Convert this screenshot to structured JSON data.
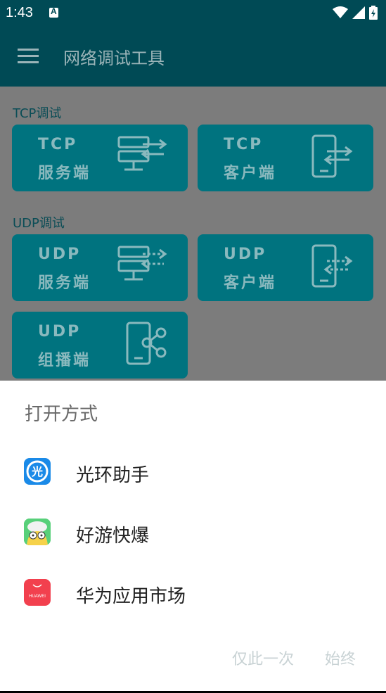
{
  "status": {
    "time": "1:43",
    "notif_letter": "A"
  },
  "app_bar": {
    "title": "网络调试工具"
  },
  "sections": {
    "tcp": {
      "label": "TCP调试"
    },
    "udp": {
      "label": "UDP调试"
    }
  },
  "cards": {
    "tcp_server": {
      "line1": "TCP",
      "line2": "服务端"
    },
    "tcp_client": {
      "line1": "TCP",
      "line2": "客户端"
    },
    "udp_server": {
      "line1": "UDP",
      "line2": "服务端"
    },
    "udp_client": {
      "line1": "UDP",
      "line2": "客户端"
    },
    "udp_multicast": {
      "line1": "UDP",
      "line2": "组播端"
    }
  },
  "sheet": {
    "title": "打开方式",
    "apps": [
      {
        "name": "光环助手",
        "icon": "guanghuan-icon"
      },
      {
        "name": "好游快爆",
        "icon": "haoyou-icon"
      },
      {
        "name": "华为应用市场",
        "icon": "huawei-appgallery-icon"
      }
    ],
    "huawei_icon_text": "HUAWEI",
    "btn_once": "仅此一次",
    "btn_always": "始终"
  },
  "colors": {
    "app_bar": "#004a55",
    "card": "#00737f",
    "dim_bg": "#7c7c7c",
    "disabled_button": "#c8d2d4"
  }
}
